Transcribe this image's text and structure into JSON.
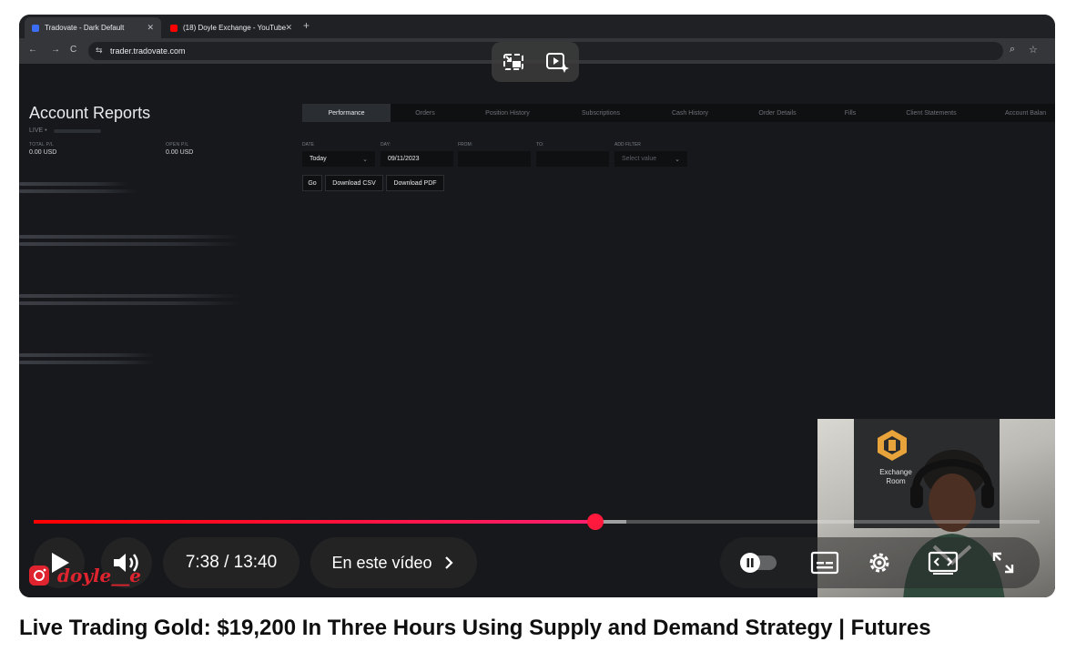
{
  "browser": {
    "tabs": [
      {
        "title": "Tradovate - Dark Default",
        "active": true
      },
      {
        "title": "(18) Doyle Exchange - YouTube",
        "active": false
      }
    ],
    "url": "trader.tradovate.com"
  },
  "tradovate": {
    "title": "Account Reports",
    "live_label": "LIVE •",
    "total_pl_label": "TOTAL P/L",
    "total_pl_value": "0.00 USD",
    "open_pl_label": "OPEN P/L",
    "open_pl_value": "0.00 USD",
    "tabs": [
      "Performance",
      "Orders",
      "Position History",
      "Subscriptions",
      "Cash History",
      "Order Details",
      "Fills",
      "Client Statements",
      "Account Balan"
    ],
    "filters": {
      "date_label": "DATE",
      "date_value": "Today",
      "day_label": "DAY:",
      "day_value": "09/11/2023",
      "from_label": "FROM:",
      "to_label": "TO:",
      "add_filter_label": "ADD FILTER",
      "add_filter_placeholder": "Select value"
    },
    "buttons": {
      "go": "Go",
      "download_csv": "Download CSV",
      "download_pdf": "Download PDF"
    }
  },
  "webcam": {
    "sign_text_1": "Exchange",
    "sign_text_2": "Room"
  },
  "player": {
    "current_time": "7:38",
    "duration": "13:40",
    "time_display": "7:38 / 13:40",
    "progress_fraction": 0.558,
    "chapter_label": "En este vídeo",
    "accent_color": "#ff0000"
  },
  "watermark": {
    "handle": "doyle__e"
  },
  "video_title": "Live Trading Gold: $19,200 In Three Hours Using Supply and Demand Strategy | Futures"
}
